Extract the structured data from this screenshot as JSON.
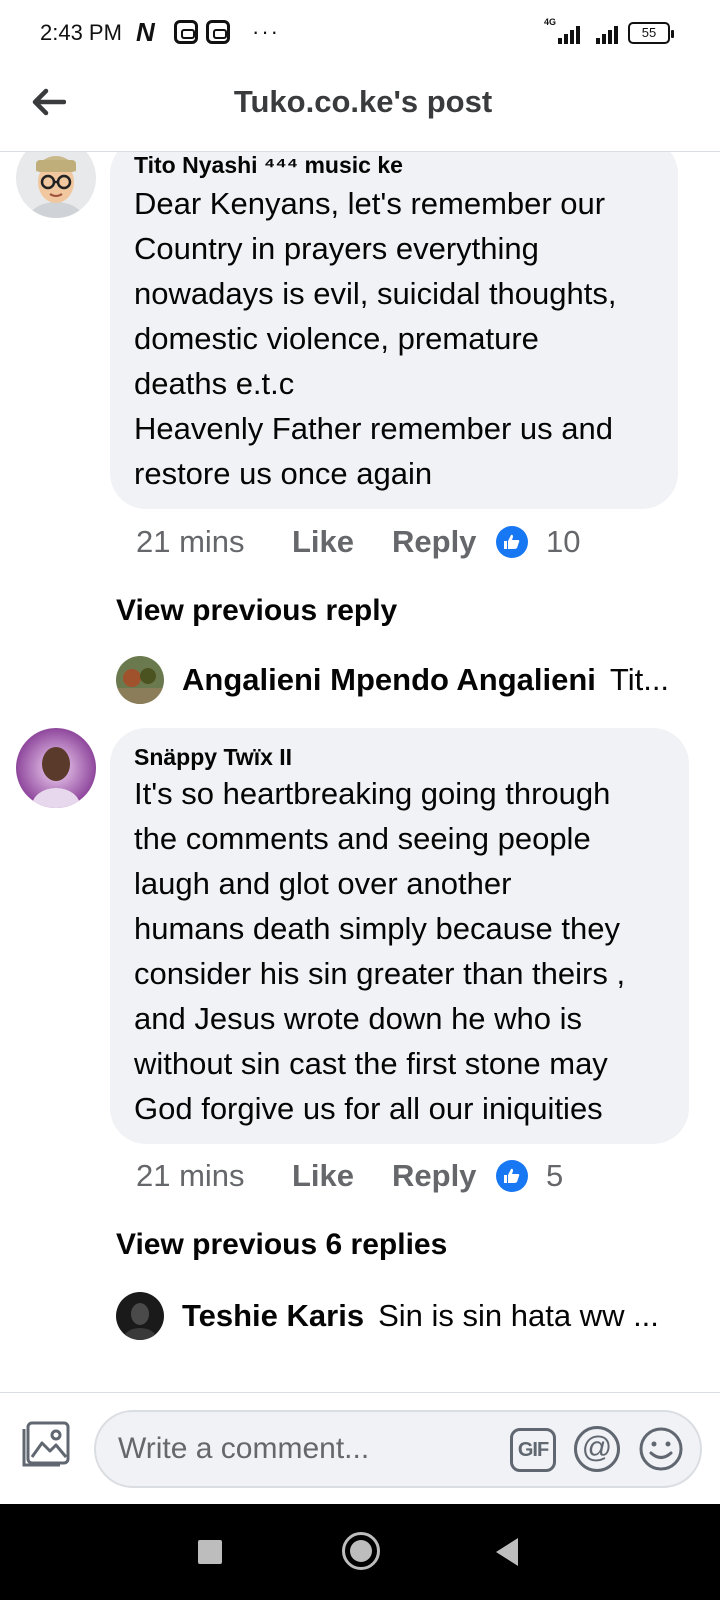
{
  "status_bar": {
    "time": "2:43 PM",
    "network_label": "4G",
    "battery": "55",
    "more": "···"
  },
  "header": {
    "title": "Tuko.co.ke's post",
    "back_icon": "arrow-left-icon"
  },
  "comments": [
    {
      "author": "Tito Nyashi ⁴⁴⁴ music ke",
      "lines": [
        "Dear Kenyans, let's remember our",
        "Country in prayers everything",
        "nowadays is evil, suicidal thoughts,",
        "domestic violence, premature",
        "deaths e.t.c",
        "Heavenly Father remember us and",
        "restore us once again"
      ],
      "time": "21 mins",
      "like_label": "Like",
      "reply_label": "Reply",
      "reactions": "10",
      "view_previous": "View previous reply",
      "reply_preview": {
        "name": "Angalieni Mpendo Angalieni",
        "snippet": "Tit..."
      }
    },
    {
      "author": "Snäppy Twïx II",
      "lines": [
        "It's so heartbreaking going through",
        "the comments and seeing people",
        "laugh and glot over another",
        "humans death simply because they",
        "consider his sin greater than theirs ,",
        "and Jesus wrote down he who is",
        "without sin cast the first stone may",
        "God forgive us for all our iniquities"
      ],
      "time": "21 mins",
      "like_label": "Like",
      "reply_label": "Reply",
      "reactions": "5",
      "view_previous": "View previous 6 replies",
      "reply_preview": {
        "name": "Teshie Karis",
        "snippet": "Sin is sin hata ww ..."
      }
    }
  ],
  "composer": {
    "placeholder": "Write a comment...",
    "gif_label": "GIF",
    "mention_label": "@"
  },
  "colors": {
    "bubble": "#f0f2f5",
    "like_blue": "#1877f2",
    "secondary_text": "#65676b"
  }
}
